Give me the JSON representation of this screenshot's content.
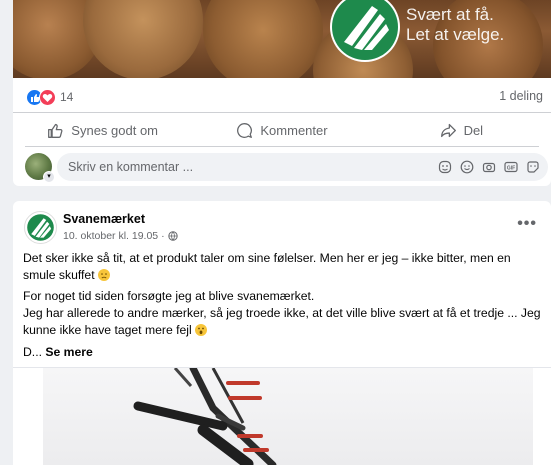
{
  "ad": {
    "tagline_line1": "Svært at få.",
    "tagline_line2": "Let at vælge."
  },
  "reactions": {
    "count": "14",
    "shares": "1 deling"
  },
  "actions": {
    "like": "Synes godt om",
    "comment": "Kommenter",
    "share": "Del"
  },
  "comment_box": {
    "placeholder": "Skriv en kommentar ..."
  },
  "post": {
    "page_name": "Svanemærket",
    "timestamp": "10. oktober kl. 19.05 ·",
    "paragraph1": "Det sker ikke så tit, at et produkt taler om sine følelser. Men her er jeg – ikke bitter, men en smule skuffet",
    "paragraph2_line1": "For noget tid siden forsøgte jeg at blive svanemærket.",
    "paragraph2_line2": "Jeg har allerede to andre mærker, så jeg troede ikke, at det ville blive svært at få et tredje ... Jeg kunne ikke have taget mere fejl",
    "truncated": "D...",
    "see_more": "Se mere"
  },
  "colors": {
    "brand_green": "#1e8a4c",
    "link_blue": "#1877f2",
    "love_red": "#f33e58"
  }
}
